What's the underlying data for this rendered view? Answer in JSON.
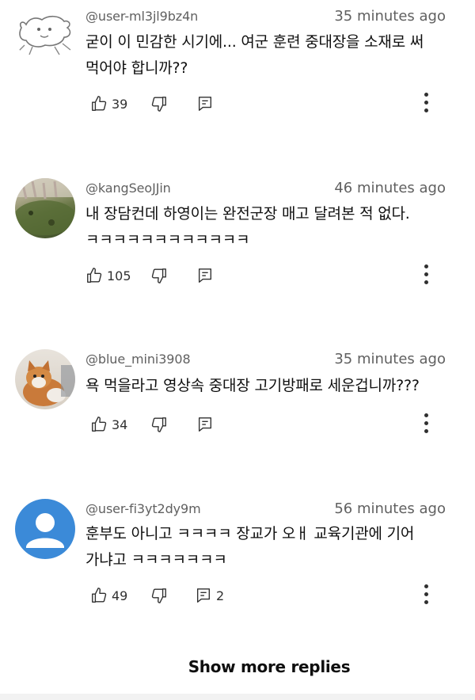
{
  "comments": [
    {
      "author": "@user-ml3jl9bz4n",
      "time": "35 minutes ago",
      "text_lines": [
        "굳이 이 민감한 시기에... 여군 훈련 중대장을 소재로 써",
        "먹어야 합니까??"
      ],
      "likes": "39",
      "replies": "",
      "avatar": "doodle-avatar"
    },
    {
      "author": "@kangSeoJJin",
      "time": "46 minutes ago",
      "text_lines": [
        "내 장담컨데 하영이는 완전군장 매고 달려본 적 없다.",
        "ㅋㅋㅋㅋㅋㅋㅋㅋㅋㅋㅋㅋ"
      ],
      "likes": "105",
      "replies": "",
      "avatar": "nature-photo-avatar"
    },
    {
      "author": "@blue_mini3908",
      "time": "35 minutes ago",
      "text_lines": [
        "욕 먹을라고 영상속 중대장 고기방패로 세운겁니까???"
      ],
      "likes": "34",
      "replies": "",
      "avatar": "cat-photo-avatar"
    },
    {
      "author": "@user-fi3yt2dy9m",
      "time": "56 minutes ago",
      "text_lines": [
        "훈부도 아니고 ㅋㅋㅋㅋ 장교가 오ㅐ 교육기관에 기어",
        "가냐고 ㅋㅋㅋㅋㅋㅋㅋ"
      ],
      "likes": "49",
      "replies": "2",
      "avatar": "default-person-avatar"
    }
  ],
  "show_more": "Show more replies",
  "colors": {
    "default_avatar_bg": "#3b8ad8",
    "meta_text": "#606060"
  }
}
